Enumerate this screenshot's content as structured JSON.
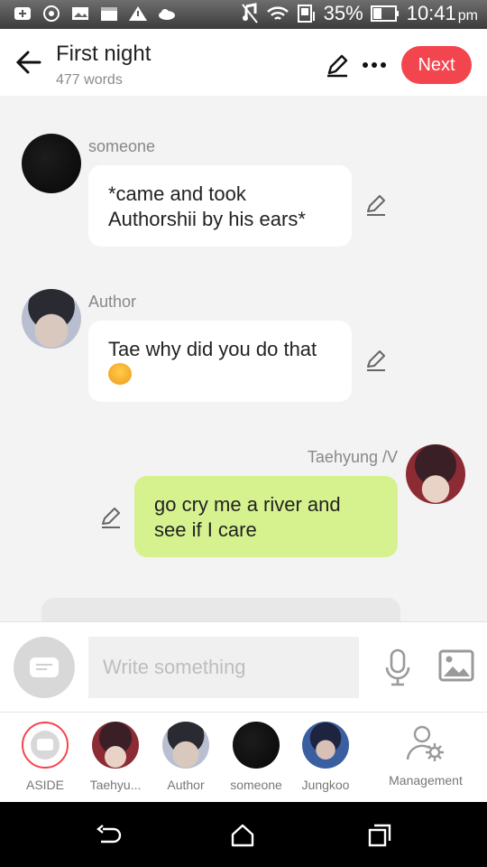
{
  "status_bar": {
    "battery": "35%",
    "time": "10:41",
    "ampm": "pm"
  },
  "header": {
    "title": "First night",
    "word_count": "477 words",
    "next_label": "Next"
  },
  "messages": [
    {
      "speaker": "someone",
      "text": "*came and took Authorshii by his ears*",
      "side": "left"
    },
    {
      "speaker": "Author",
      "text": "Tae why did you do that",
      "emoji": "tired-face",
      "side": "left"
    },
    {
      "speaker": "Taehyung /V",
      "text": "go cry me a river and see if I care",
      "side": "right"
    }
  ],
  "composer": {
    "placeholder": "Write something"
  },
  "characters": [
    {
      "label": "ASIDE"
    },
    {
      "label": "Taehyu..."
    },
    {
      "label": "Author"
    },
    {
      "label": "someone"
    },
    {
      "label": "Jungkoo"
    },
    {
      "label": "Management"
    }
  ],
  "colors": {
    "accent": "#f3454e",
    "right_bubble": "#d6f28f",
    "left_bubble": "#ffffff"
  }
}
